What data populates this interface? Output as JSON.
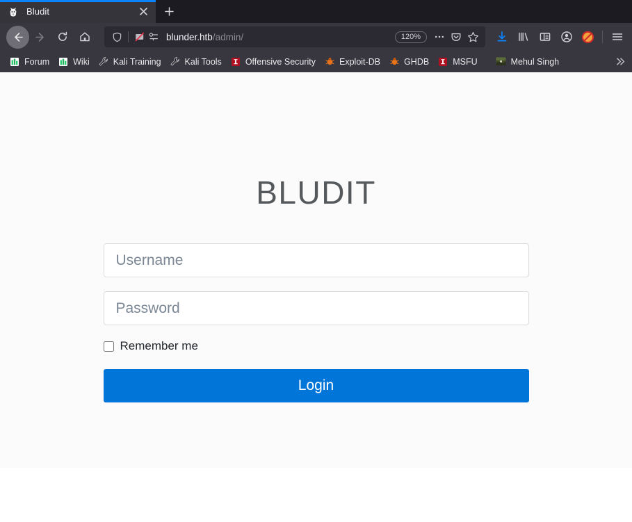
{
  "browser": {
    "tab": {
      "title": "Bludit",
      "favicon_icon": "bludit-cat-favicon",
      "close_icon": "close-icon"
    },
    "new_tab_icon": "plus-icon",
    "nav": {
      "back_icon": "arrow-left-icon",
      "forward_icon": "arrow-right-icon",
      "reload_icon": "reload-icon",
      "home_icon": "home-icon"
    },
    "url_bar": {
      "shield_icon": "shield-icon",
      "tracker_blocked_icon": "tracker-blocked-icon",
      "permissions_icon": "permissions-key-icon",
      "url_host": "blunder.htb",
      "url_path": "/admin/",
      "zoom_level": "120%",
      "page_actions_icon": "ellipsis-icon",
      "reader_icon": "pocket-icon",
      "bookmark_icon": "star-icon"
    },
    "toolbar_icons": [
      {
        "name": "downloads-icon",
        "glyph": "download"
      },
      {
        "name": "library-icon",
        "glyph": "library"
      },
      {
        "name": "sidebar-icon",
        "glyph": "sidebar"
      },
      {
        "name": "account-icon",
        "glyph": "account"
      },
      {
        "name": "adblock-extension-icon",
        "glyph": "adblock"
      },
      {
        "name": "app-menu-icon",
        "glyph": "hamburger"
      }
    ],
    "bookmarks": [
      {
        "label": "Forum",
        "icon": "kali-bars-icon"
      },
      {
        "label": "Wiki",
        "icon": "kali-bars-icon"
      },
      {
        "label": "Kali Training",
        "icon": "wrench-icon"
      },
      {
        "label": "Kali Tools",
        "icon": "wrench-icon"
      },
      {
        "label": "Offensive Security",
        "icon": "offsec-icon"
      },
      {
        "label": "Exploit-DB",
        "icon": "bug-icon"
      },
      {
        "label": "GHDB",
        "icon": "bug-icon"
      },
      {
        "label": "MSFU",
        "icon": "metasploit-icon"
      },
      {
        "label": "Mehul Singh",
        "icon": "photo-thumbnail-icon"
      }
    ],
    "bookmarks_overflow_icon": "chevron-double-right-icon"
  },
  "page": {
    "brand_title": "BLUDIT",
    "username": {
      "placeholder": "Username",
      "value": ""
    },
    "password": {
      "placeholder": "Password",
      "value": ""
    },
    "remember_me_label": "Remember me",
    "remember_me_checked": false,
    "login_button_label": "Login"
  },
  "colors": {
    "accent_blue": "#0275d8",
    "tab_accent": "#0a84ff",
    "chrome_bg": "#38373f",
    "tabstrip_bg": "#1c1b22",
    "page_bg": "#fbfbfc",
    "brand_text": "#55595c",
    "placeholder_text": "#7b8794"
  }
}
